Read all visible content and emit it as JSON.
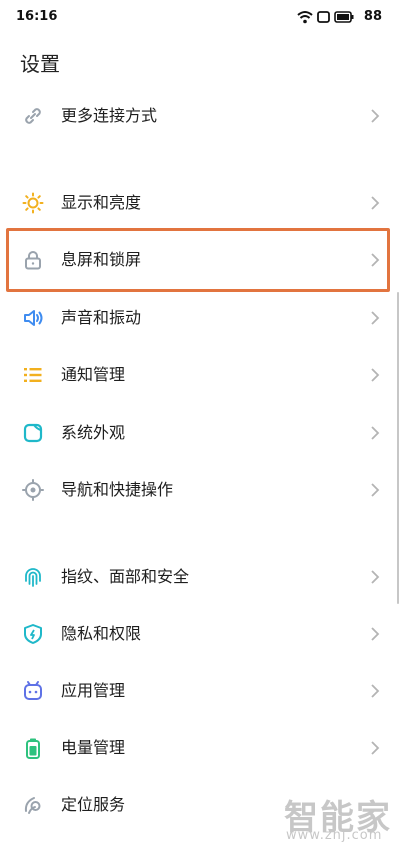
{
  "status_bar": {
    "time": "16:16",
    "battery": "88",
    "icons": [
      "wifi-icon",
      "rotation-lock-icon",
      "battery-icon"
    ]
  },
  "page": {
    "title": "设置"
  },
  "settings": [
    {
      "label": "更多连接方式",
      "icon": "link-icon",
      "color": "#9aa3ad"
    },
    {
      "label": "显示和亮度",
      "icon": "brightness-icon",
      "color": "#f2b01e"
    },
    {
      "label": "息屏和锁屏",
      "icon": "lock-icon",
      "color": "#9aa3ad",
      "highlighted": true
    },
    {
      "label": "声音和振动",
      "icon": "speaker-icon",
      "color": "#3f8cf0"
    },
    {
      "label": "通知管理",
      "icon": "notification-list-icon",
      "color": "#f2b01e"
    },
    {
      "label": "系统外观",
      "icon": "appearance-icon",
      "color": "#1fb8c9"
    },
    {
      "label": "导航和快捷操作",
      "icon": "navigation-icon",
      "color": "#9aa3ad"
    },
    {
      "label": "指纹、面部和安全",
      "icon": "fingerprint-icon",
      "color": "#1fb8c9"
    },
    {
      "label": "隐私和权限",
      "icon": "privacy-shield-icon",
      "color": "#1fb8c9"
    },
    {
      "label": "应用管理",
      "icon": "app-management-icon",
      "color": "#5f72e6"
    },
    {
      "label": "电量管理",
      "icon": "battery-management-icon",
      "color": "#2ec27e"
    },
    {
      "label": "定位服务",
      "icon": "location-icon",
      "color": "#9aa3ad"
    }
  ],
  "highlight_color": "#e2743f",
  "watermark": {
    "brand": "智能家",
    "url": "www.znj.com"
  }
}
